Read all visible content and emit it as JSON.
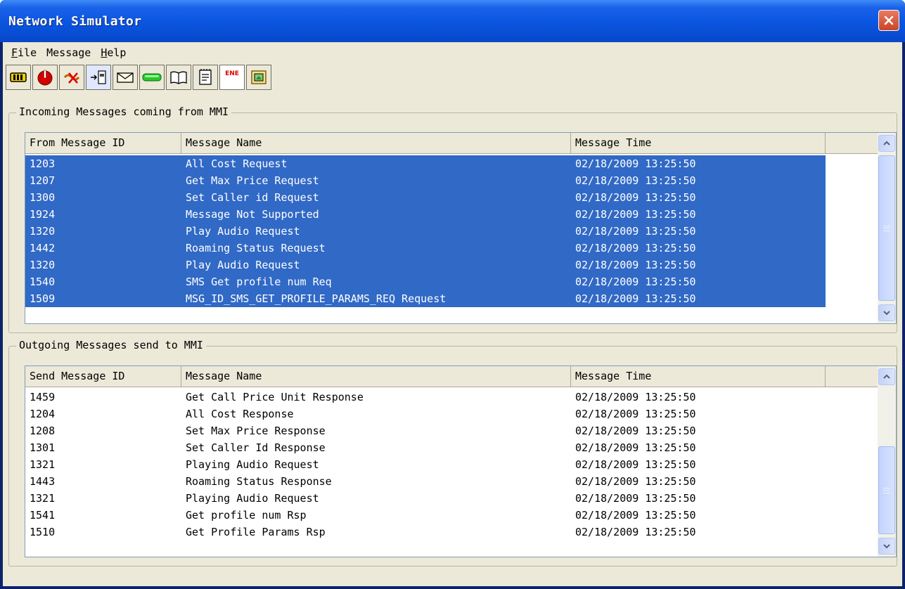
{
  "window": {
    "title": "Network Simulator"
  },
  "menu": [
    {
      "key": "F",
      "rest": "ile"
    },
    {
      "key": "",
      "rest": "Message"
    },
    {
      "key": "H",
      "rest": "elp"
    }
  ],
  "toolbar": {
    "icons": [
      "battery-icon",
      "power-icon",
      "tools-icon",
      "sim-card-icon",
      "envelope-icon",
      "green-bar-icon",
      "book-icon",
      "notepad-icon",
      "ene-icon",
      "picture-icon"
    ],
    "ene_label": "ENE"
  },
  "incoming": {
    "title": "Incoming Messages coming from MMI",
    "columns": [
      "From Message ID",
      "Message Name",
      "Message Time",
      ""
    ],
    "rows": [
      {
        "id": "1203",
        "name": "All Cost Request",
        "time": "02/18/2009 13:25:50"
      },
      {
        "id": "1207",
        "name": "Get Max Price Request",
        "time": "02/18/2009 13:25:50"
      },
      {
        "id": "1300",
        "name": "Set Caller id Request",
        "time": "02/18/2009 13:25:50"
      },
      {
        "id": "1924",
        "name": "Message Not Supported",
        "time": "02/18/2009 13:25:50"
      },
      {
        "id": "1320",
        "name": "Play Audio Request",
        "time": "02/18/2009 13:25:50"
      },
      {
        "id": "1442",
        "name": "Roaming Status Request",
        "time": "02/18/2009 13:25:50"
      },
      {
        "id": "1320",
        "name": "Play Audio Request",
        "time": "02/18/2009 13:25:50"
      },
      {
        "id": "1540",
        "name": "SMS Get profile num Req",
        "time": "02/18/2009 13:25:50"
      },
      {
        "id": "1509",
        "name": "MSG_ID_SMS_GET_PROFILE_PARAMS_REQ Request",
        "time": "02/18/2009 13:25:50"
      }
    ]
  },
  "outgoing": {
    "title": "Outgoing Messages send to MMI",
    "columns": [
      "Send Message ID",
      "Message Name",
      "Message Time",
      ""
    ],
    "rows": [
      {
        "id": "1459",
        "name": "Get Call Price Unit Response",
        "time": "02/18/2009 13:25:50"
      },
      {
        "id": "1204",
        "name": "All Cost Response",
        "time": "02/18/2009 13:25:50"
      },
      {
        "id": "1208",
        "name": "Set Max Price Response",
        "time": "02/18/2009 13:25:50"
      },
      {
        "id": "1301",
        "name": "Set Caller Id Response",
        "time": "02/18/2009 13:25:50"
      },
      {
        "id": "1321",
        "name": "Playing Audio Request",
        "time": "02/18/2009 13:25:50"
      },
      {
        "id": "1443",
        "name": "Roaming Status Response",
        "time": "02/18/2009 13:25:50"
      },
      {
        "id": "1321",
        "name": "Playing Audio Request",
        "time": "02/18/2009 13:25:50"
      },
      {
        "id": "1541",
        "name": "Get profile num Rsp",
        "time": "02/18/2009 13:25:50"
      },
      {
        "id": "1510",
        "name": "Get Profile Params Rsp",
        "time": "02/18/2009 13:25:50"
      }
    ]
  },
  "colors": {
    "selection": "#3169c6",
    "titlebar": "#0a55e0",
    "face": "#ece9d8"
  }
}
